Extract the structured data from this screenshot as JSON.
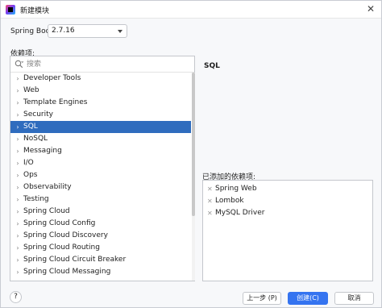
{
  "window": {
    "title": "新建模块",
    "close_glyph": "✕"
  },
  "spring_boot": {
    "label": "Spring Boot:",
    "selected_version": "2.7.16"
  },
  "dependencies": {
    "label": "依赖项:",
    "search_placeholder": "搜索",
    "categories": [
      {
        "label": "Developer Tools",
        "arrow": "›",
        "selected": false
      },
      {
        "label": "Web",
        "arrow": "›",
        "selected": false
      },
      {
        "label": "Template Engines",
        "arrow": "›",
        "selected": false
      },
      {
        "label": "Security",
        "arrow": "›",
        "selected": false
      },
      {
        "label": "SQL",
        "arrow": "›",
        "selected": true
      },
      {
        "label": "NoSQL",
        "arrow": "›",
        "selected": false
      },
      {
        "label": "Messaging",
        "arrow": "›",
        "selected": false
      },
      {
        "label": "I/O",
        "arrow": "›",
        "selected": false
      },
      {
        "label": "Ops",
        "arrow": "›",
        "selected": false
      },
      {
        "label": "Observability",
        "arrow": "›",
        "selected": false
      },
      {
        "label": "Testing",
        "arrow": "›",
        "selected": false
      },
      {
        "label": "Spring Cloud",
        "arrow": "›",
        "selected": false
      },
      {
        "label": "Spring Cloud Config",
        "arrow": "›",
        "selected": false
      },
      {
        "label": "Spring Cloud Discovery",
        "arrow": "›",
        "selected": false
      },
      {
        "label": "Spring Cloud Routing",
        "arrow": "›",
        "selected": false
      },
      {
        "label": "Spring Cloud Circuit Breaker",
        "arrow": "›",
        "selected": false
      },
      {
        "label": "Spring Cloud Messaging",
        "arrow": "›",
        "selected": false
      }
    ]
  },
  "detail": {
    "title": "SQL"
  },
  "added": {
    "label": "已添加的依赖项:",
    "remove_glyph": "✕",
    "items": [
      "Spring Web",
      "Lombok",
      "MySQL Driver"
    ]
  },
  "footer": {
    "help_glyph": "?",
    "prev_label": "上一步 (P)",
    "create_label": "创建(C)",
    "cancel_label": "取消"
  },
  "colors": {
    "selection": "#2f6cbe",
    "primary_button": "#3574f0"
  }
}
